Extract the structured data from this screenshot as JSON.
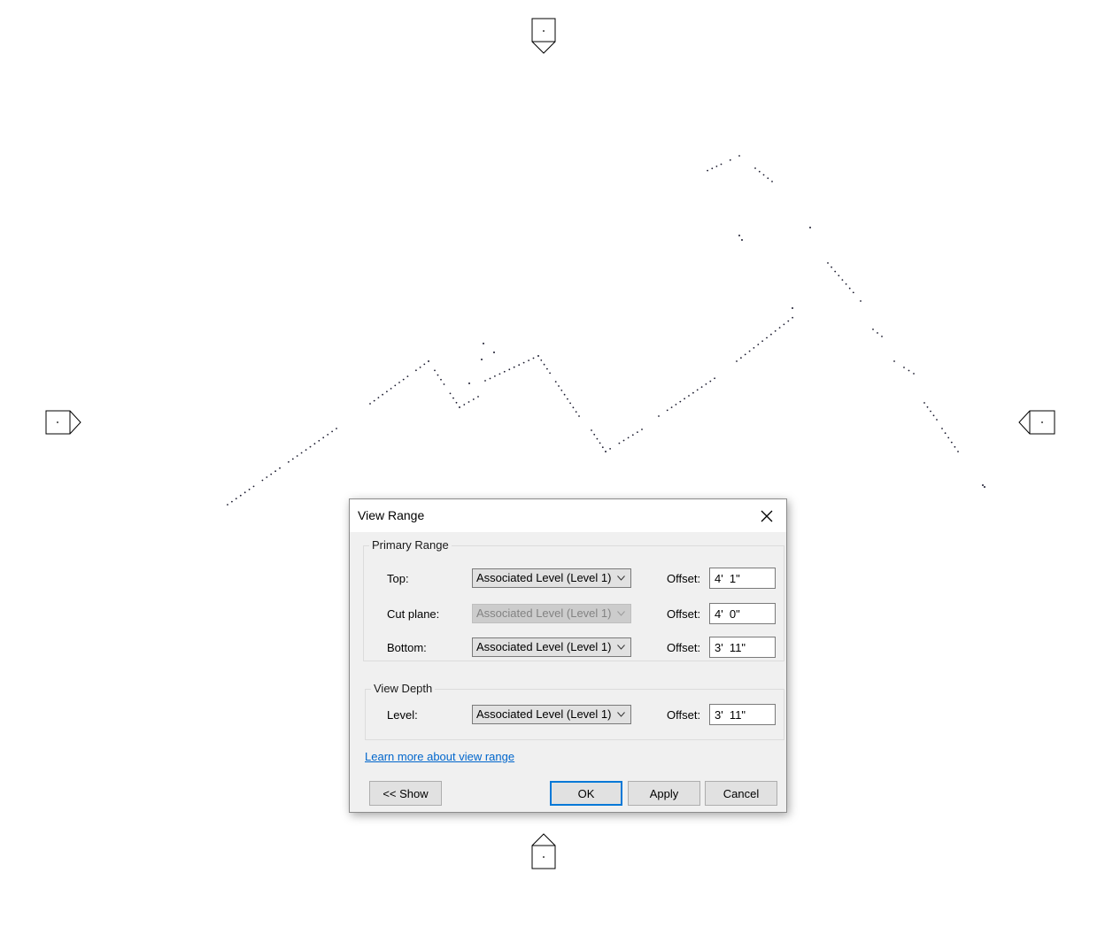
{
  "dialog": {
    "title": "View Range",
    "primary_range": {
      "label": "Primary Range",
      "rows": [
        {
          "label": "Top:",
          "level": "Associated Level (Level 1)",
          "offset_label": "Offset:",
          "offset": "4'  1\""
        },
        {
          "label": "Cut plane:",
          "level": "Associated Level (Level 1)",
          "offset_label": "Offset:",
          "offset": "4'  0\""
        },
        {
          "label": "Bottom:",
          "level": "Associated Level (Level 1)",
          "offset_label": "Offset:",
          "offset": "3'  11\""
        }
      ]
    },
    "view_depth": {
      "label": "View Depth",
      "row": {
        "label": "Level:",
        "level": "Associated Level (Level 1)",
        "offset_label": "Offset:",
        "offset": "3'  11\""
      }
    },
    "link": "Learn more about view range",
    "buttons": {
      "show": "<< Show",
      "ok": "OK",
      "apply": "Apply",
      "cancel": "Cancel"
    }
  },
  "canvas": {
    "elevation_markers": [
      "north",
      "south",
      "east",
      "west"
    ],
    "line_color": "#1a1a2e"
  },
  "colors": {
    "accent": "#0078d7",
    "link": "#0066cc"
  }
}
